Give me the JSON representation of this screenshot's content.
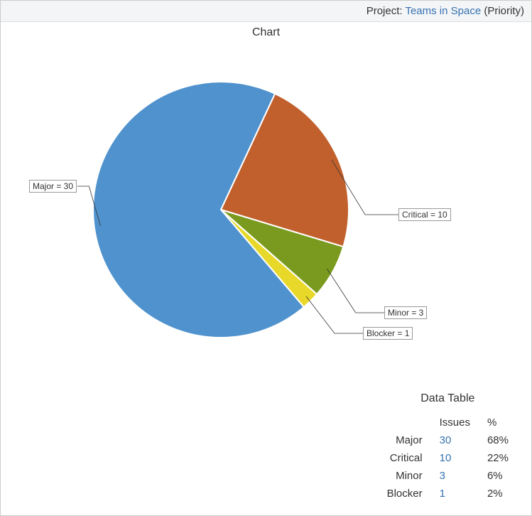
{
  "header": {
    "prefix": "Project: ",
    "project_name": "Teams in Space",
    "suffix": " (Priority)"
  },
  "chart_title": "Chart",
  "data_table_title": "Data Table",
  "table_headers": {
    "issues": "Issues",
    "percent": "%"
  },
  "rows": [
    {
      "label": "Major",
      "count": "30",
      "percent": "68%"
    },
    {
      "label": "Critical",
      "count": "10",
      "percent": "22%"
    },
    {
      "label": "Minor",
      "count": "3",
      "percent": "6%"
    },
    {
      "label": "Blocker",
      "count": "1",
      "percent": "2%"
    }
  ],
  "slice_labels": {
    "major": "Major = 30",
    "critical": "Critical = 10",
    "minor": "Minor = 3",
    "blocker": "Blocker = 1"
  },
  "chart_data": {
    "type": "pie",
    "title": "Project: Teams in Space (Priority)",
    "categories": [
      "Major",
      "Critical",
      "Minor",
      "Blocker"
    ],
    "values": [
      30,
      10,
      3,
      1
    ],
    "percentages": [
      68,
      22,
      6,
      2
    ],
    "colors": [
      "#4f92cd",
      "#c1602c",
      "#7a9a1f",
      "#e8d829"
    ]
  }
}
